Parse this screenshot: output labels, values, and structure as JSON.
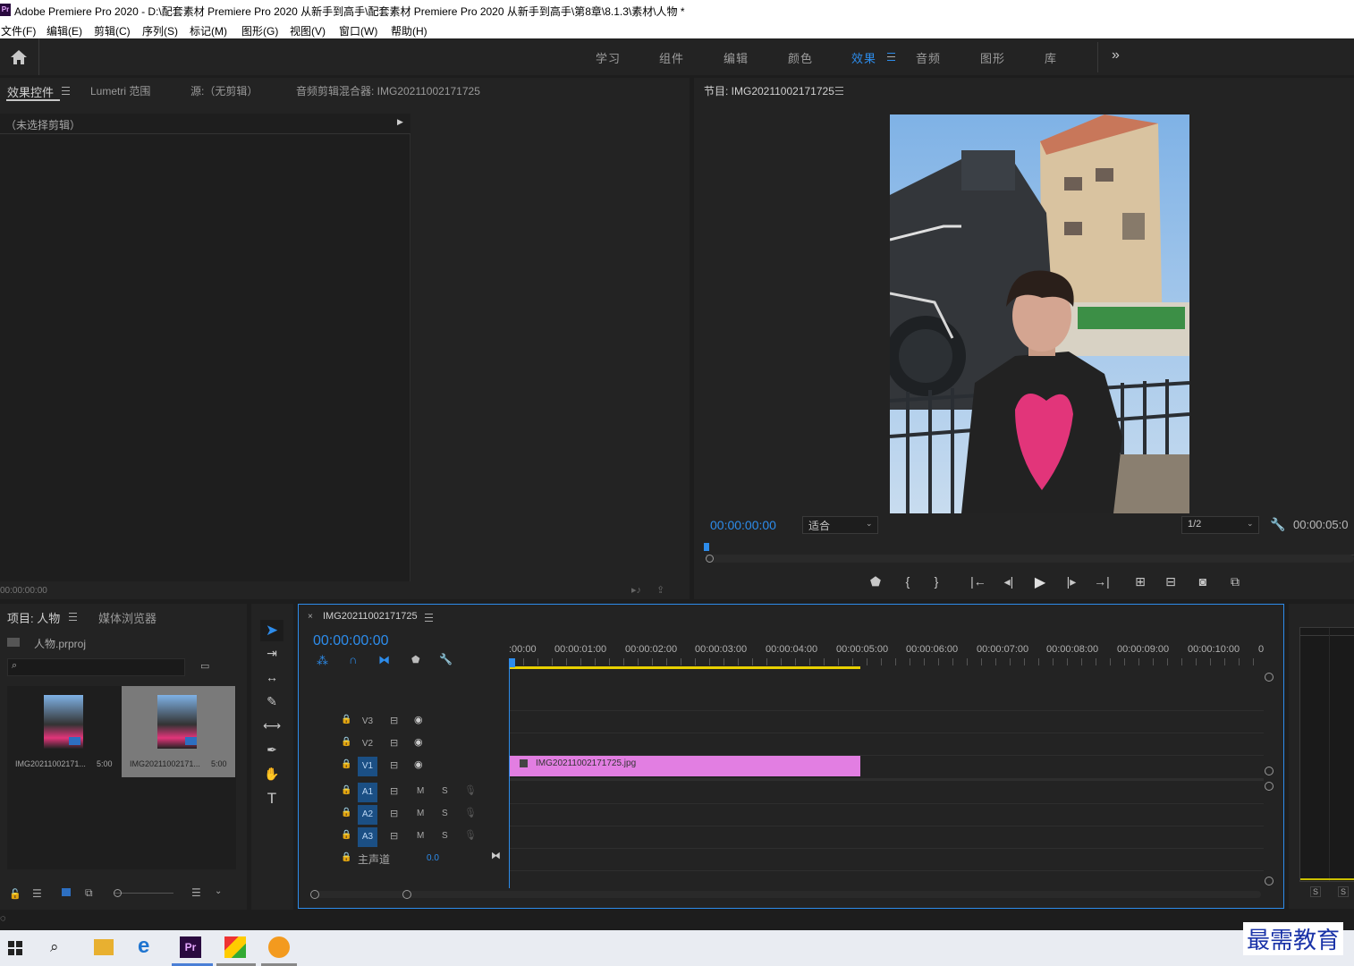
{
  "window": {
    "title": "Adobe Premiere Pro 2020 - D:\\配套素材 Premiere Pro 2020 从新手到高手\\配套素材 Premiere Pro 2020 从新手到高手\\第8章\\8.1.3\\素材\\人物 *",
    "app_badge": "Pr"
  },
  "menu": [
    "文件(F)",
    "编辑(E)",
    "剪辑(C)",
    "序列(S)",
    "标记(M)",
    "图形(G)",
    "视图(V)",
    "窗口(W)",
    "帮助(H)"
  ],
  "workspaces": {
    "items": [
      "学习",
      "组件",
      "编辑",
      "颜色",
      "效果",
      "音频",
      "图形",
      "库"
    ],
    "active": "效果",
    "more": "»"
  },
  "source_panel": {
    "tabs": [
      "效果控件",
      "Lumetri 范围",
      "源:（无剪辑）",
      "音频剪辑混合器: IMG20211002171725"
    ],
    "no_clip": "（未选择剪辑）",
    "timecode": "00:00:00:00"
  },
  "program_monitor": {
    "title": "节目: IMG20211002171725",
    "timecode": "00:00:00:00",
    "fit": "适合",
    "resolution": "1/2",
    "duration": "00:00:05:0"
  },
  "project_panel": {
    "tabs": [
      "项目: 人物",
      "媒体浏览器"
    ],
    "project_file": "人物.prproj",
    "items": [
      {
        "name": "IMG20211002171...",
        "duration": "5:00"
      },
      {
        "name": "IMG20211002171...",
        "duration": "5:00"
      }
    ]
  },
  "timeline": {
    "tab": "IMG20211002171725",
    "timecode": "00:00:00:00",
    "ruler": [
      ":00:00",
      "00:00:01:00",
      "00:00:02:00",
      "00:00:03:00",
      "00:00:04:00",
      "00:00:05:00",
      "00:00:06:00",
      "00:00:07:00",
      "00:00:08:00",
      "00:00:09:00",
      "00:00:10:00",
      "0"
    ],
    "video_tracks": [
      "V3",
      "V2",
      "V1"
    ],
    "audio_tracks": [
      "A1",
      "A2",
      "A3"
    ],
    "mute_label": "M",
    "solo_label": "S",
    "master": {
      "label": "主声道",
      "value": "0.0"
    },
    "clip": {
      "name": "IMG20211002171725.jpg",
      "color": "#e27ee2"
    }
  },
  "audio_meter": {
    "s1": "S",
    "s2": "S"
  },
  "watermark": "最需教育",
  "colors": {
    "accent": "#2d8ceb",
    "clip": "#e27ee2",
    "work_area": "#e8d000"
  }
}
